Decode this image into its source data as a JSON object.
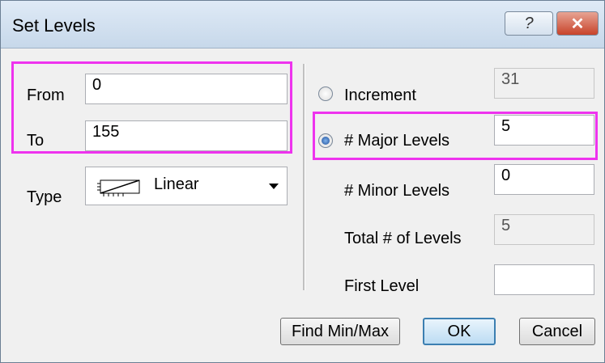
{
  "window": {
    "title": "Set Levels",
    "help_label": "?",
    "close_label": "✕"
  },
  "left": {
    "from_label": "From",
    "from_value": "0",
    "to_label": "To",
    "to_value": "155",
    "type_label": "Type",
    "type_value": "Linear"
  },
  "right": {
    "increment_label": "Increment",
    "increment_value": "31",
    "major_label": "# Major Levels",
    "major_value": "5",
    "minor_label": "# Minor Levels",
    "minor_value": "0",
    "total_label": "Total # of Levels",
    "total_value": "5",
    "first_label": "First Level",
    "first_value": ""
  },
  "buttons": {
    "find_label": "Find Min/Max",
    "ok_label": "OK",
    "cancel_label": "Cancel"
  },
  "colors": {
    "highlight": "#ee33ee",
    "title_bar": "#c7d8ea"
  }
}
